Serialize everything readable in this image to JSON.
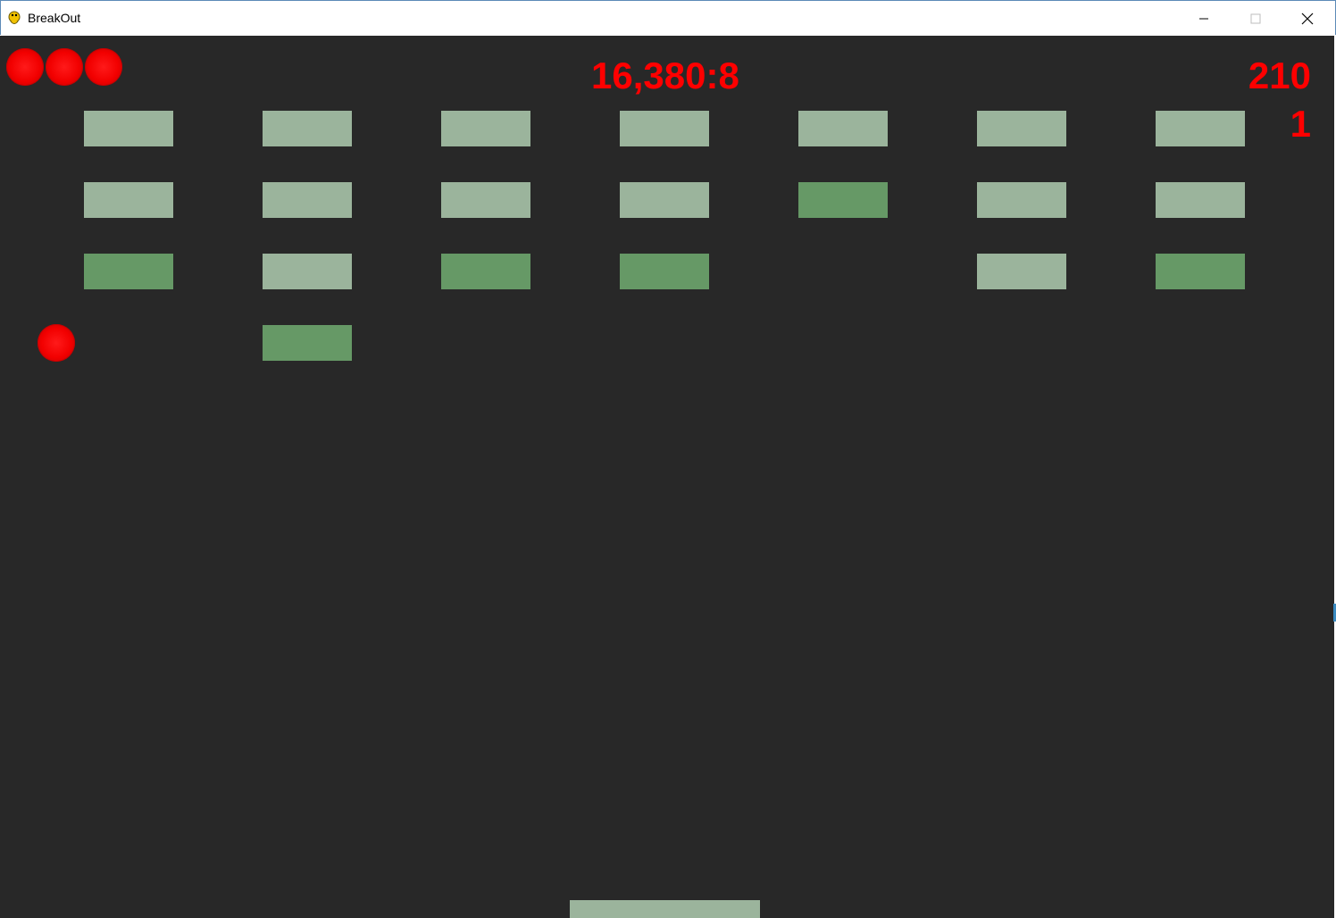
{
  "window": {
    "title": "BreakOut",
    "app_icon": "python-snake-icon",
    "controls": {
      "minimize_icon": "minimize-icon",
      "maximize_icon": "maximize-icon",
      "close_icon": "close-icon"
    }
  },
  "hud": {
    "lives_remaining": 3,
    "center_readout": "16,380:8",
    "score": "210",
    "level": "1",
    "text_color": "#ff0000"
  },
  "game": {
    "background_color": "#282828",
    "brick_colors": {
      "light": "#9bb49c",
      "dark": "#669966"
    },
    "bricks": [
      [
        "light",
        "light",
        "light",
        "light",
        "light",
        "light",
        "light"
      ],
      [
        "light",
        "light",
        "light",
        "light",
        "dark",
        "light",
        "light"
      ],
      [
        "dark",
        "light",
        "dark",
        "dark",
        null,
        "light",
        "dark"
      ],
      [
        null,
        "dark",
        null,
        null,
        null,
        null,
        null
      ]
    ],
    "ball_color": "#ff0000",
    "paddle_color": "#9bb49c"
  }
}
